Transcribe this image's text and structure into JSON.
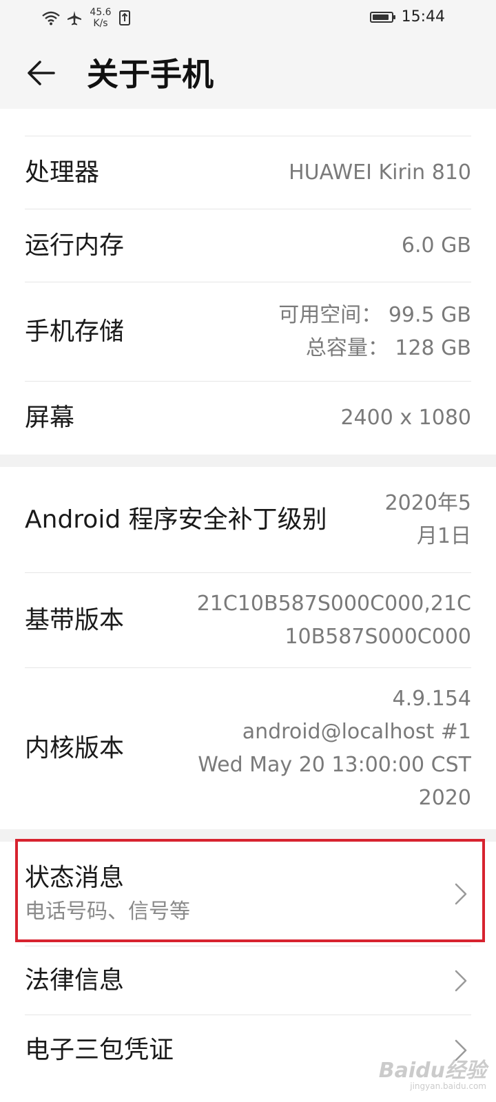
{
  "status_bar": {
    "net_speed_value": "45.6",
    "net_speed_unit": "K/s",
    "time": "15:44",
    "battery_level": 0.9
  },
  "header": {
    "title": "关于手机"
  },
  "rows": {
    "cpu": {
      "label": "处理器",
      "value": "HUAWEI Kirin 810"
    },
    "ram": {
      "label": "运行内存",
      "value": "6.0 GB"
    },
    "storage": {
      "label": "手机存储",
      "available": "可用空间： 99.5  GB",
      "total": "总容量： 128  GB"
    },
    "screen": {
      "label": "屏幕",
      "value": "2400 x 1080"
    },
    "security_patch": {
      "label": "Android 程序安全补丁级别",
      "value_line1": "2020年5",
      "value_line2": "月1日"
    },
    "baseband": {
      "label": "基带版本",
      "value_line1": "21C10B587S000C000,21C",
      "value_line2": "10B587S000C000"
    },
    "kernel": {
      "label": "内核版本",
      "lines": [
        "4.9.154",
        "android@localhost #1",
        "Wed May 20 13:00:00 CST",
        "2020"
      ]
    }
  },
  "nav": {
    "status_info": {
      "title": "状态消息",
      "subtitle": "电话号码、信号等"
    },
    "legal": {
      "title": "法律信息"
    },
    "certificate": {
      "title": "电子三包凭证"
    }
  },
  "watermark": {
    "main": "Baidu经验",
    "sub": "jingyan.baidu.com"
  },
  "colors": {
    "highlight_border": "#d7232f",
    "header_bg": "#f5f5f5",
    "section_gap": "#f2f2f2",
    "secondary_text": "#7a7a7a"
  }
}
